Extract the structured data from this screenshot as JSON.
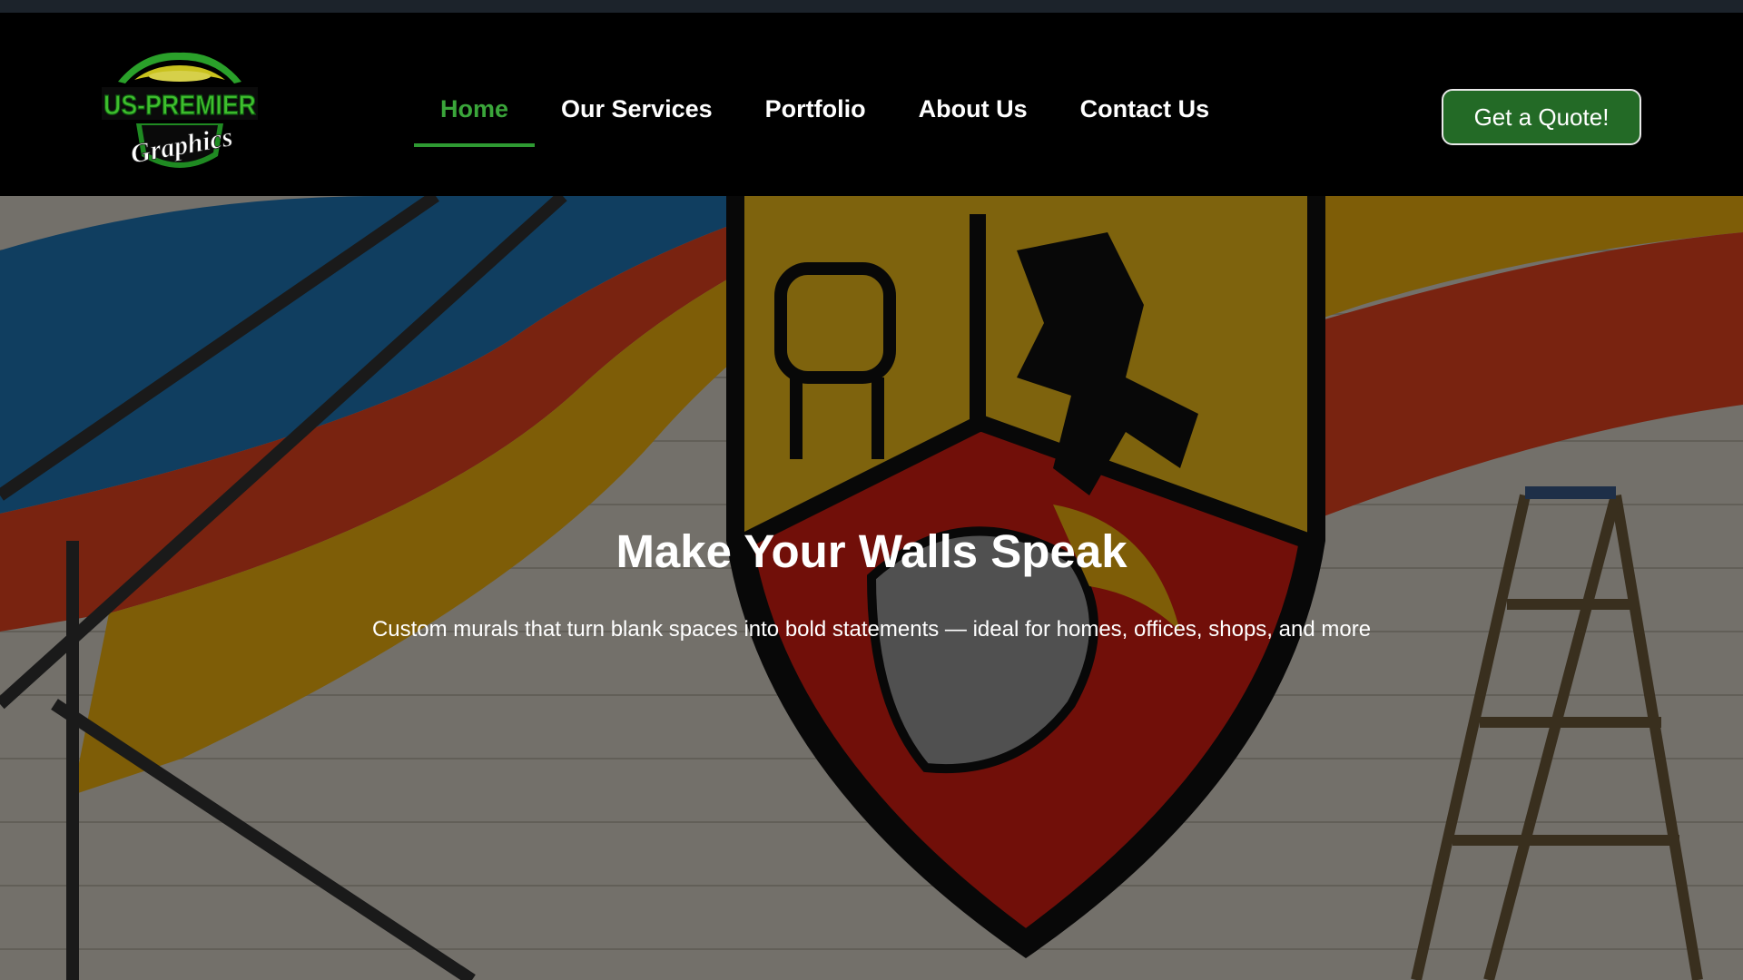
{
  "brand": {
    "logo_line1": "US-PREMIER",
    "logo_line2": "Graphics",
    "accent_color": "#2e9a32"
  },
  "nav": {
    "items": [
      {
        "label": "Home",
        "active": true
      },
      {
        "label": "Our Services",
        "active": false
      },
      {
        "label": "Portfolio",
        "active": false
      },
      {
        "label": "About Us",
        "active": false
      },
      {
        "label": "Contact Us",
        "active": false
      }
    ]
  },
  "cta": {
    "label": "Get a Quote!",
    "color": "#236a26"
  },
  "hero": {
    "title": "Make Your Walls Speak",
    "subtitle": "Custom murals that turn blank spaces into bold statements — ideal for homes, offices, shops, and more"
  }
}
